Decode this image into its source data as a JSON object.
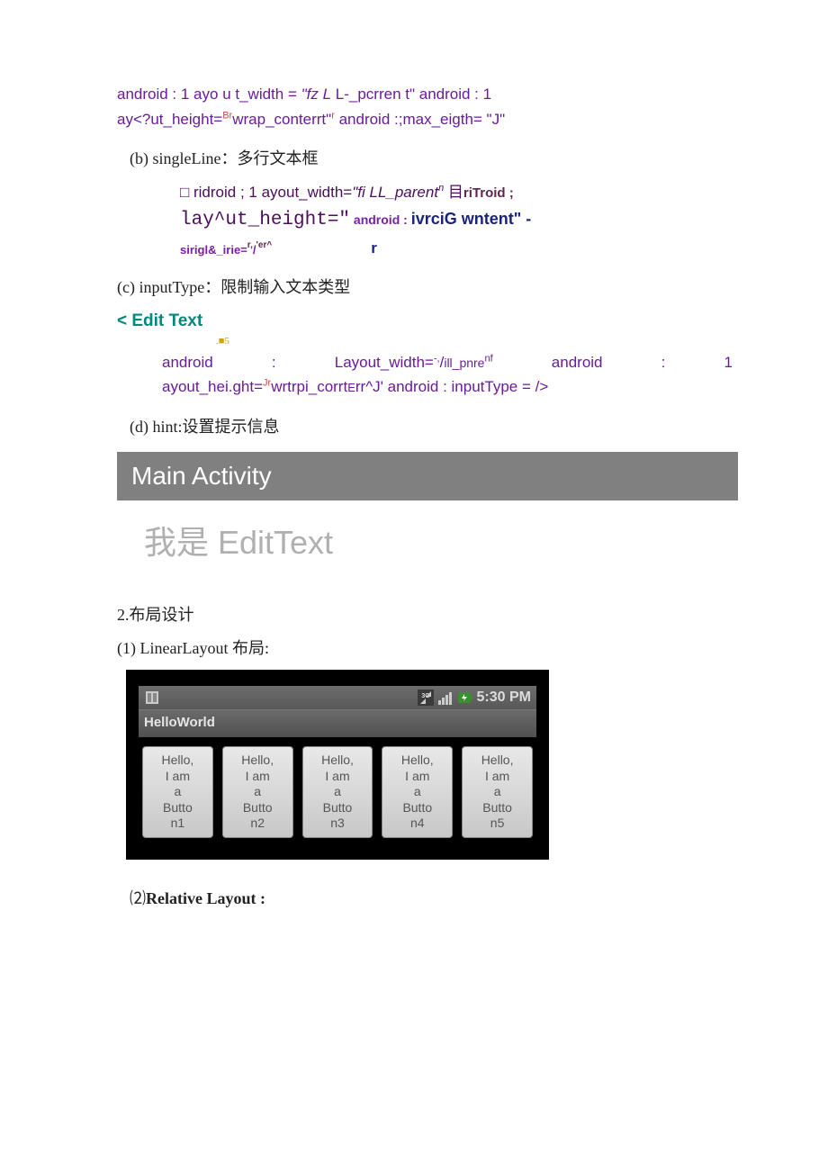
{
  "para1": {
    "l1a": "android : 1 ayo u t_width = ",
    "l1b": "\"fz L",
    "l1c": " L-_pcrren t\"",
    "l1d": " android : 1",
    "l2a": "ay<?ut_height=",
    "l2b": "Br",
    "l2c": "wrap_conterrt\"",
    "l2d": "r",
    "l2e": " android :;max_eigth= \"J\""
  },
  "item_b": "(b) singleLine：多行文本框",
  "code_b": {
    "l1a": "□ ridroid ; 1 ayout_width=",
    "l1b": "\"fi LL_parent",
    "l1c": "n",
    "l1d": " 目",
    "l1e": "riTroid ;",
    "l2a": "lay^ut_height=\"",
    "l2b": " android : ",
    "l2c": "ivrciG wntent\" -",
    "l3a": "sirigl&_irie=",
    "l3b": "r,",
    "l3c": "/",
    "l3d": "'er^",
    "l3e": "r"
  },
  "item_c": "(c) inputType：限制输入文本类型",
  "edit_tag": "< Edit Text",
  "tiny_sq": ".■5",
  "code_c": {
    "l1a": "android",
    "colon1": ":",
    "l1b": "Layout_width=",
    "l1c": "-,",
    "l1d": "/",
    "l1e": "ill_pnre",
    "l1f": "nf",
    "l1g": "android",
    "colon2": ":",
    "l1h": "1",
    "l2a": "ayout_hei.ght=",
    "l2b": "Jr",
    "l2c": "wrtrpi_corrt",
    "l2d": "E",
    "l2e": "rr^J'",
    "l2f": " android : inputType = />"
  },
  "item_d": "(d) hint:设置提示信息",
  "grey_bar": "Main Activity",
  "edit_hint": "我是 EditText",
  "sec2": "2.布局设计",
  "sec2_1": "(1) LinearLayout 布局:",
  "phone": {
    "time": "5:30 PM",
    "app_title": "HelloWorld",
    "buttons": [
      {
        "l1": "Hello,",
        "l2": "I am",
        "l3": "a",
        "l4": "Butto",
        "l5": "n1"
      },
      {
        "l1": "Hello,",
        "l2": "I am",
        "l3": "a",
        "l4": "Butto",
        "l5": "n2"
      },
      {
        "l1": "Hello,",
        "l2": "I am",
        "l3": "a",
        "l4": "Butto",
        "l5": "n3"
      },
      {
        "l1": "Hello,",
        "l2": "I am",
        "l3": "a",
        "l4": "Butto",
        "l5": "n4"
      },
      {
        "l1": "Hello,",
        "l2": "I am",
        "l3": "a",
        "l4": "Butto",
        "l5": "n5"
      }
    ]
  },
  "sec2_2a": "⑵",
  "sec2_2b": "Relative Layout :"
}
